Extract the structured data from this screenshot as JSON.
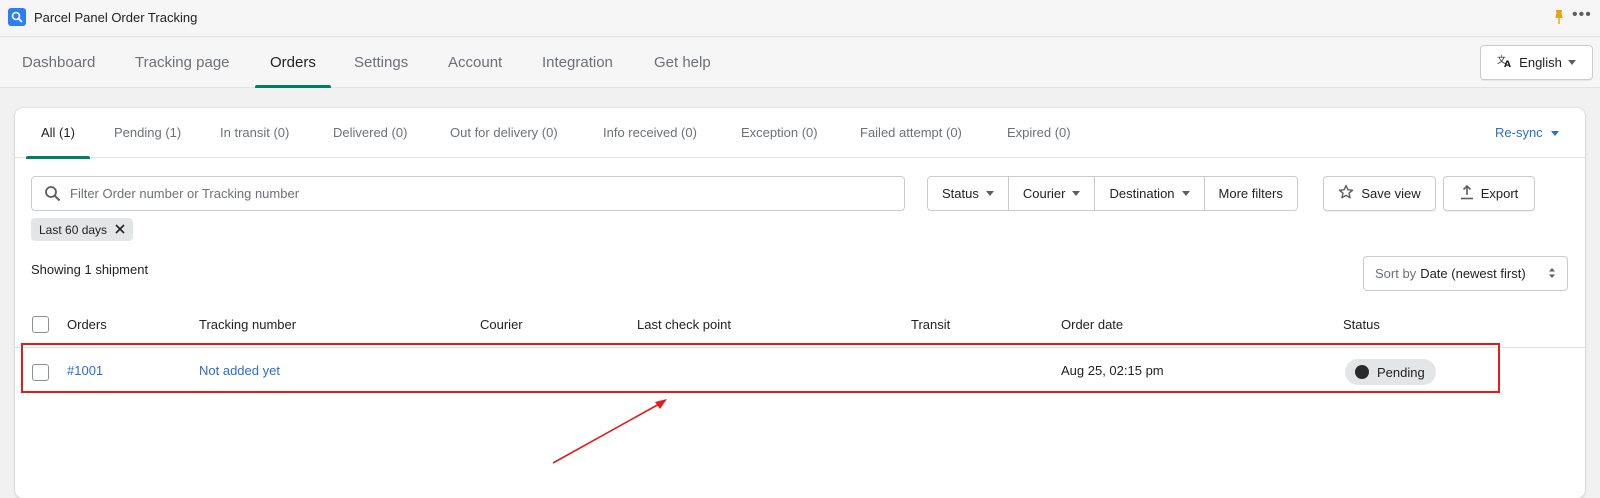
{
  "app": {
    "title": "Parcel Panel Order Tracking",
    "logo_icon": "magnifier-logo-icon",
    "accent_color": "#008060",
    "link_color": "#2c6ecb"
  },
  "nav": {
    "tabs": [
      {
        "label": "Dashboard"
      },
      {
        "label": "Tracking page"
      },
      {
        "label": "Orders",
        "active": true
      },
      {
        "label": "Settings"
      },
      {
        "label": "Account"
      },
      {
        "label": "Integration"
      },
      {
        "label": "Get help"
      }
    ],
    "language_button": "English"
  },
  "subtabs": {
    "items": [
      {
        "label": "All (1)",
        "active": true
      },
      {
        "label": "Pending (1)"
      },
      {
        "label": "In transit (0)"
      },
      {
        "label": "Delivered (0)"
      },
      {
        "label": "Out for delivery (0)"
      },
      {
        "label": "Info received (0)"
      },
      {
        "label": "Exception (0)"
      },
      {
        "label": "Failed attempt (0)"
      },
      {
        "label": "Expired (0)"
      }
    ],
    "resync_label": "Re-sync"
  },
  "filters": {
    "search_placeholder": "Filter Order number or Tracking number",
    "status_label": "Status",
    "courier_label": "Courier",
    "destination_label": "Destination",
    "more_filters_label": "More filters",
    "save_view_label": "Save view",
    "export_label": "Export",
    "active_chip": "Last 60 days"
  },
  "summary": {
    "showing_text": "Showing 1 shipment",
    "sort_prefix": "Sort by",
    "sort_value": "Date (newest first)"
  },
  "table": {
    "columns": {
      "orders": "Orders",
      "tracking_number": "Tracking number",
      "courier": "Courier",
      "last_check_point": "Last check point",
      "transit": "Transit",
      "order_date": "Order date",
      "status": "Status"
    },
    "rows": [
      {
        "order": "#1001",
        "tracking_number": "Not added yet",
        "courier": "",
        "last_check_point": "",
        "transit": "",
        "order_date": "Aug 25, 02:15 pm",
        "status": "Pending"
      }
    ]
  },
  "annotation": {
    "highlight_color": "#e11c1c"
  }
}
